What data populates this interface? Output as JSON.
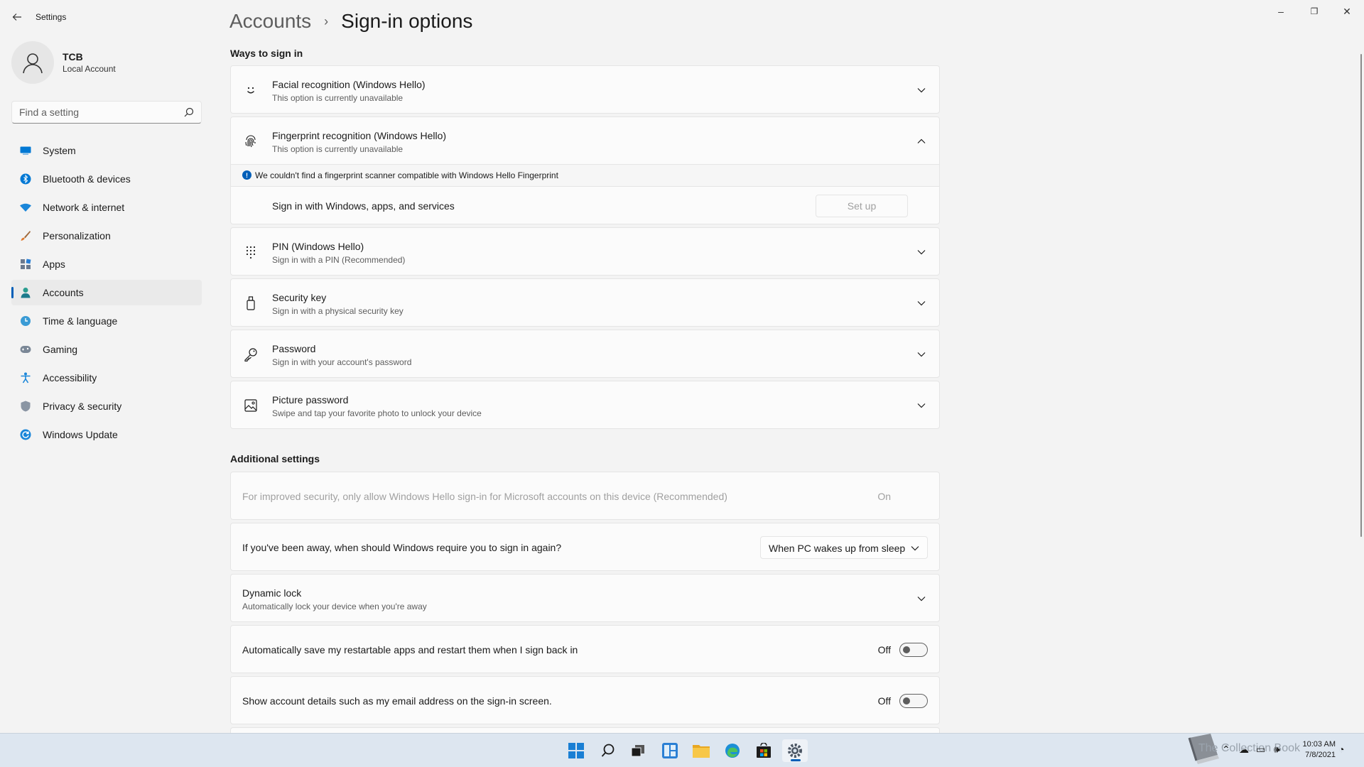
{
  "window": {
    "title": "Settings",
    "controls": {
      "minimize": "–",
      "restore": "❐",
      "close": "✕"
    }
  },
  "profile": {
    "name": "TCB",
    "account_type": "Local Account"
  },
  "search": {
    "placeholder": "Find a setting"
  },
  "sidebar": {
    "items": [
      {
        "label": "System",
        "icon": "monitor-icon"
      },
      {
        "label": "Bluetooth & devices",
        "icon": "bluetooth-icon"
      },
      {
        "label": "Network & internet",
        "icon": "wifi-icon"
      },
      {
        "label": "Personalization",
        "icon": "brush-icon"
      },
      {
        "label": "Apps",
        "icon": "apps-icon"
      },
      {
        "label": "Accounts",
        "icon": "person-icon",
        "active": true
      },
      {
        "label": "Time & language",
        "icon": "globe-clock-icon"
      },
      {
        "label": "Gaming",
        "icon": "gamepad-icon"
      },
      {
        "label": "Accessibility",
        "icon": "accessibility-icon"
      },
      {
        "label": "Privacy & security",
        "icon": "shield-icon"
      },
      {
        "label": "Windows Update",
        "icon": "update-icon"
      }
    ]
  },
  "breadcrumb": {
    "parent": "Accounts",
    "separator": "›",
    "current": "Sign-in options"
  },
  "ways": {
    "heading": "Ways to sign in",
    "facial": {
      "title": "Facial recognition (Windows Hello)",
      "sub": "This option is currently unavailable"
    },
    "fingerprint": {
      "title": "Fingerprint recognition (Windows Hello)",
      "sub": "This option is currently unavailable",
      "info": "We couldn't find a fingerprint scanner compatible with Windows Hello Fingerprint",
      "signin_label": "Sign in with Windows, apps, and services",
      "setup_button": "Set up"
    },
    "pin": {
      "title": "PIN (Windows Hello)",
      "sub": "Sign in with a PIN (Recommended)"
    },
    "security_key": {
      "title": "Security key",
      "sub": "Sign in with a physical security key"
    },
    "password": {
      "title": "Password",
      "sub": "Sign in with your account's password"
    },
    "picture_password": {
      "title": "Picture password",
      "sub": "Swipe and tap your favorite photo to unlock your device"
    }
  },
  "additional": {
    "heading": "Additional settings",
    "hello_only": {
      "label": "For improved security, only allow Windows Hello sign-in for Microsoft accounts on this device (Recommended)",
      "state": "On"
    },
    "require_signin": {
      "label": "If you've been away, when should Windows require you to sign in again?",
      "selected": "When PC wakes up from sleep"
    },
    "dynamic_lock": {
      "title": "Dynamic lock",
      "sub": "Automatically lock your device when you're away"
    },
    "restart_apps": {
      "label": "Automatically save my restartable apps and restart them when I sign back in",
      "state": "Off"
    },
    "account_details": {
      "label": "Show account details such as my email address on the sign-in screen.",
      "state": "Off"
    }
  },
  "taskbar": {
    "apps": [
      "windows-start-icon",
      "search-icon",
      "task-view-icon",
      "widgets-icon",
      "file-explorer-icon",
      "edge-icon",
      "store-icon",
      "settings-icon"
    ],
    "watermark": "The Collection Book",
    "time": "10:03 AM",
    "date": "7/8/2021"
  },
  "colors": {
    "accent": "#005fb8",
    "background": "#f3f3f3",
    "card": "#fbfbfb"
  }
}
